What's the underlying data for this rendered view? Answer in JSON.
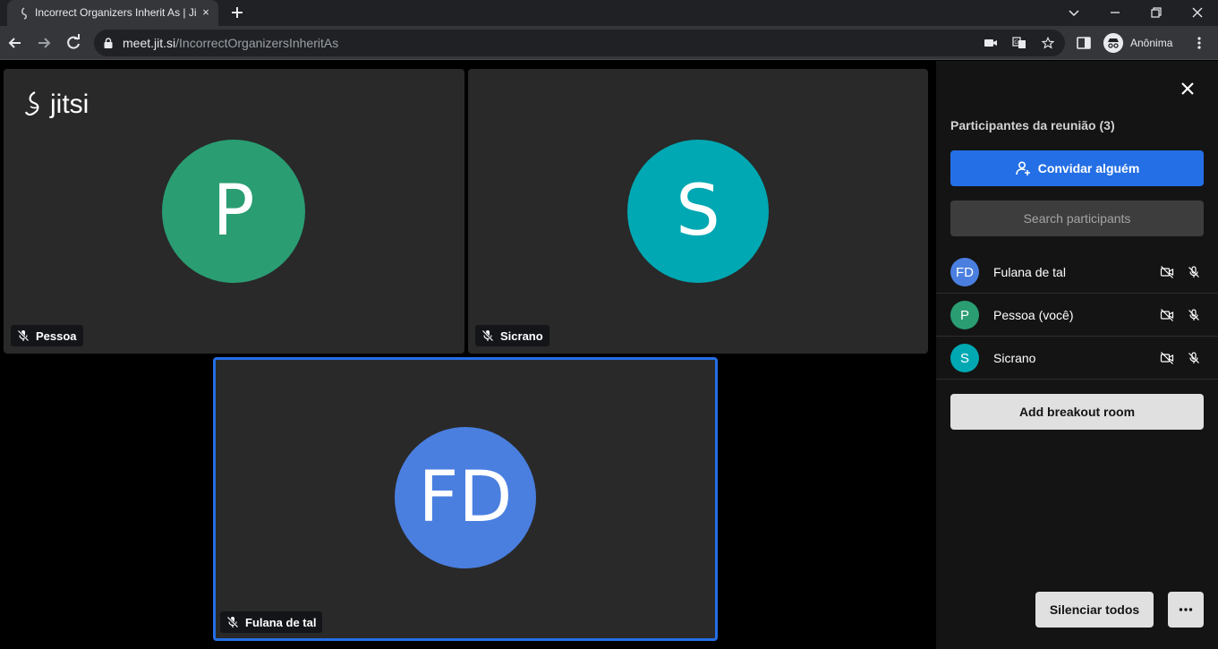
{
  "browser": {
    "tab_title": "Incorrect Organizers Inherit As | Jitsi Meet",
    "tab_close": "×",
    "url_host": "meet.jit.si",
    "url_path": "/IncorrectOrganizersInheritAs",
    "profile_label": "Anônima"
  },
  "stage": {
    "logo_text": "jitsi",
    "tiles": [
      {
        "initials": "P",
        "name": "Pessoa",
        "color": "#2a9d73",
        "active": false
      },
      {
        "initials": "S",
        "name": "Sicrano",
        "color": "#00a8b3",
        "active": false
      },
      {
        "initials": "FD",
        "name": "Fulana de tal",
        "color": "#4a7fe0",
        "active": true
      }
    ]
  },
  "panel": {
    "title": "Participantes da reunião (3)",
    "invite_label": "Convidar alguém",
    "search_placeholder": "Search participants",
    "participants": [
      {
        "initials": "FD",
        "name": "Fulana de tal",
        "color": "#4a7fe0"
      },
      {
        "initials": "P",
        "name": "Pessoa (você)",
        "color": "#2a9d73"
      },
      {
        "initials": "S",
        "name": "Sicrano",
        "color": "#00a8b3"
      }
    ],
    "breakout_label": "Add breakout room",
    "mute_all_label": "Silenciar todos"
  },
  "icons": {
    "muted_mic": "mic-off-icon",
    "camera_off": "camera-off-icon",
    "close": "close-icon",
    "more": "more-horizontal-icon",
    "add_person": "add-person-icon"
  }
}
